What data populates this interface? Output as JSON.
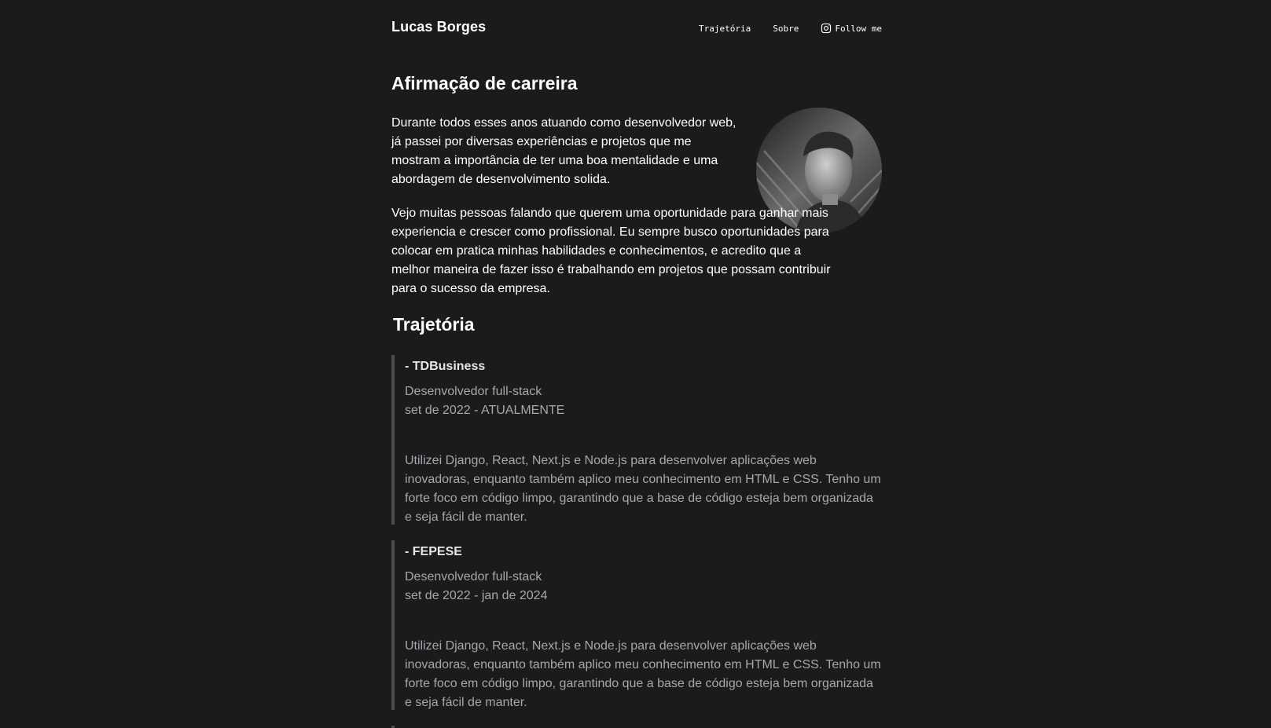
{
  "header": {
    "brand": "Lucas Borges",
    "nav": {
      "trajectory": "Trajetória",
      "about": "Sobre",
      "follow": "Follow me",
      "follow_icon": "instagram-icon"
    }
  },
  "intro": {
    "title": "Afirmação de carreira",
    "paragraphs": [
      "Durante todos esses anos atuando como desenvolvedor web, já passei por diversas experiências e projetos que me mostram a importância de ter uma boa mentalidade e uma abordagem de desenvolvimento solida.",
      "Vejo muitas pessoas falando que querem uma oportunidade para ganhar mais experiencia e crescer como profissional. Eu sempre busco oportunidades para colocar em pratica minhas habilidades e conhecimentos, e acredito que a melhor maneira de fazer isso é trabalhando em projetos que possam contribuir para o sucesso da empresa."
    ]
  },
  "trajectory": {
    "title": "Trajetória",
    "jobs": [
      {
        "company": "- TDBusiness",
        "role": "Desenvolvedor full-stack",
        "period": "set de 2022 - ATUALMENTE",
        "description": "Utilizei Django, React, Next.js e Node.js para desenvolver aplicações web inovadoras, enquanto também aplico meu conhecimento em HTML e CSS. Tenho um forte foco em código limpo, garantindo que a base de código esteja bem organizada e seja fácil de manter."
      },
      {
        "company": "- FEPESE",
        "role": "Desenvolvedor full-stack",
        "period": "set de 2022 - jan de 2024",
        "description": "Utilizei Django, React, Next.js e Node.js para desenvolver aplicações web inovadoras, enquanto também aplico meu conhecimento em HTML e CSS. Tenho um forte foco em código limpo, garantindo que a base de código esteja bem organizada e seja fácil de manter."
      }
    ]
  },
  "colors": {
    "background": "#1b1b1b",
    "text": "#ffffff",
    "muted_text": "#a7a7ad",
    "timeline_border": "#4a4d54"
  }
}
